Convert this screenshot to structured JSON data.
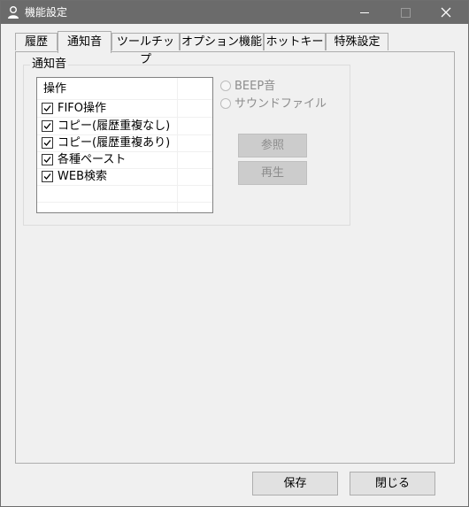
{
  "window": {
    "title": "機能設定"
  },
  "tabs": [
    {
      "label": "履歴"
    },
    {
      "label": "通知音"
    },
    {
      "label": "ツールチップ"
    },
    {
      "label": "オプション機能"
    },
    {
      "label": "ホットキー"
    },
    {
      "label": "特殊設定"
    }
  ],
  "active_tab": "通知音",
  "notify": {
    "group_label": "通知音",
    "list_header": "操作",
    "items": [
      {
        "label": "FIFO操作",
        "checked": true
      },
      {
        "label": "コピー(履歴重複なし)",
        "checked": true
      },
      {
        "label": "コピー(履歴重複あり)",
        "checked": true
      },
      {
        "label": "各種ペースト",
        "checked": true
      },
      {
        "label": "WEB検索",
        "checked": true
      }
    ],
    "radio_beep": "BEEP音",
    "radio_sound": "サウンドファイル",
    "browse_button": "参照",
    "play_button": "再生"
  },
  "footer": {
    "save_button": "保存",
    "close_button": "閉じる"
  }
}
